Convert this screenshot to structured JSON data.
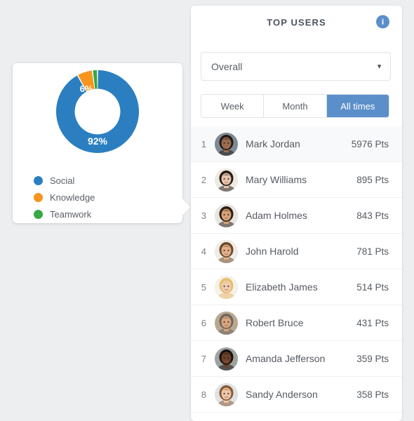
{
  "theme": {
    "page_background": "#eceef0",
    "accent_blue": "#5b8fc9",
    "chart_blue": "#2079b5",
    "chart_orange": "#f7931e",
    "chart_green": "#2ca02c",
    "text_dark": "#4a5260",
    "text_muted": "#5a5f66"
  },
  "chart_card": {
    "value_labels": {
      "social": "92%",
      "knowledge": "6%"
    },
    "legend": [
      {
        "label": "Social",
        "color": "#2b7fc0"
      },
      {
        "label": "Knowledge",
        "color": "#f7941e"
      },
      {
        "label": "Teamwork",
        "color": "#36a845"
      }
    ]
  },
  "chart_data": {
    "type": "pie",
    "title": "",
    "subtype": "donut",
    "categories": [
      "Social",
      "Knowledge",
      "Teamwork"
    ],
    "values": [
      92,
      6,
      2
    ],
    "unit": "%",
    "colors": [
      "#2b7fc0",
      "#f7941e",
      "#36a845"
    ],
    "data_labels": [
      "92%",
      "6%",
      ""
    ],
    "legend_position": "bottom-left",
    "grid": false,
    "inner_radius_ratio": 0.55
  },
  "panel": {
    "title": "TOP USERS",
    "info_icon": "info-icon",
    "info_glyph": "i",
    "filter": {
      "selected": "Overall",
      "caret": "▼"
    },
    "tabs": [
      {
        "label": "Week",
        "active": false
      },
      {
        "label": "Month",
        "active": false
      },
      {
        "label": "All times",
        "active": true
      }
    ],
    "users": [
      {
        "rank": "1",
        "name": "Mark Jordan",
        "points": "5976 Pts",
        "highlight": true,
        "avatar": "avatar-mark-jordan",
        "skin": "#9a6b4f",
        "hair": "#221a16",
        "bg": "#7e8a93"
      },
      {
        "rank": "2",
        "name": "Mary Williams",
        "points": "895 Pts",
        "highlight": false,
        "avatar": "avatar-mary-williams",
        "skin": "#e9c3ab",
        "hair": "#241a16",
        "bg": "#efe9e4"
      },
      {
        "rank": "3",
        "name": "Adam Holmes",
        "points": "843 Pts",
        "highlight": false,
        "avatar": "avatar-adam-holmes",
        "skin": "#d8a276",
        "hair": "#2b1d14",
        "bg": "#e8e4df"
      },
      {
        "rank": "4",
        "name": "John Harold",
        "points": "781 Pts",
        "highlight": false,
        "avatar": "avatar-john-harold",
        "skin": "#e2b08a",
        "hair": "#6a4a2c",
        "bg": "#efece7"
      },
      {
        "rank": "5",
        "name": "Elizabeth James",
        "points": "514 Pts",
        "highlight": false,
        "avatar": "avatar-elizabeth-james",
        "skin": "#f0cbb0",
        "hair": "#e4c06a",
        "bg": "#f4f0ea"
      },
      {
        "rank": "6",
        "name": "Robert Bruce",
        "points": "431 Pts",
        "highlight": false,
        "avatar": "avatar-robert-bruce",
        "skin": "#d9a67c",
        "hair": "#6b6560",
        "bg": "#b9a88f"
      },
      {
        "rank": "7",
        "name": "Amanda Jefferson",
        "points": "359 Pts",
        "highlight": false,
        "avatar": "avatar-amanda-jefferson",
        "skin": "#6b4229",
        "hair": "#1a1110",
        "bg": "#9ea39f"
      },
      {
        "rank": "8",
        "name": "Sandy Anderson",
        "points": "358 Pts",
        "highlight": false,
        "avatar": "avatar-sandy-anderson",
        "skin": "#edc6a8",
        "hair": "#8a5a34",
        "bg": "#dfe3e4"
      }
    ]
  }
}
